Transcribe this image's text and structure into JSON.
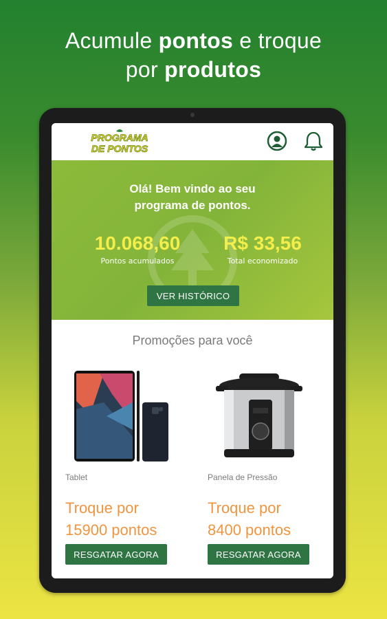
{
  "headline": {
    "line1_normal": "Acumule ",
    "line1_bold": "pontos",
    "line1_tail": " e troque",
    "line2_normal": "por ",
    "line2_bold": "produtos"
  },
  "logo": {
    "line1": "PROGRAMA",
    "line2": "DE PONTOS"
  },
  "hero": {
    "greeting_line1": "Olá! Bem vindo ao seu",
    "greeting_line2": "programa de pontos.",
    "points_value": "10.068,60",
    "points_label": "Pontos acumulados",
    "saved_value": "R$ 33,56",
    "saved_label": "Total economizado",
    "history_button": "VER HISTÓRICO"
  },
  "promotions": {
    "title": "Promoções para você",
    "items": [
      {
        "name": "Tablet",
        "trade_line1": "Troque por",
        "trade_line2": "15900 pontos",
        "button": "RESGATAR AGORA",
        "icon": "tablet-product-image"
      },
      {
        "name": "Panela de Pressão",
        "trade_line1": "Troque por",
        "trade_line2": "8400 pontos",
        "button": "RESGATAR AGORA",
        "icon": "pressure-cooker-product-image"
      }
    ]
  },
  "colors": {
    "accent_green": "#2f7543",
    "hero_green": "#8cba3a",
    "highlight_yellow": "#f3ee4b",
    "orange": "#f0953f"
  }
}
